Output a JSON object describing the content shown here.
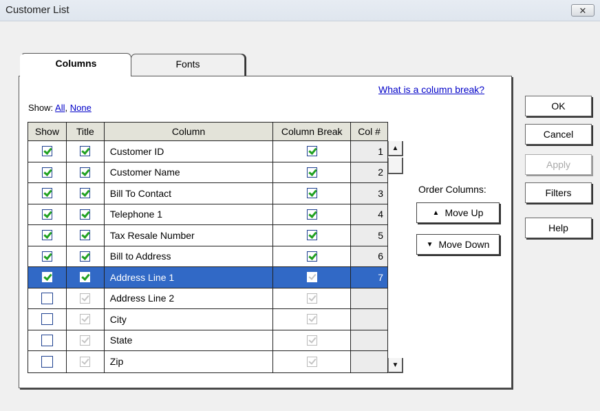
{
  "window": {
    "title": "Customer List",
    "close_glyph": "✕"
  },
  "tabs": [
    {
      "label": "Columns",
      "active": true
    },
    {
      "label": "Fonts",
      "active": false
    }
  ],
  "links": {
    "column_break_help": "What is a column break?"
  },
  "show": {
    "label": "Show:",
    "all": "All",
    "sep": ",",
    "none": "None"
  },
  "grid": {
    "headers": {
      "show": "Show",
      "title": "Title",
      "column": "Column",
      "column_break": "Column Break",
      "col_num": "Col #"
    },
    "rows": [
      {
        "show": true,
        "title": true,
        "column": "Customer ID",
        "column_break": true,
        "col_num": "1",
        "state": "normal"
      },
      {
        "show": true,
        "title": true,
        "column": "Customer Name",
        "column_break": true,
        "col_num": "2",
        "state": "normal"
      },
      {
        "show": true,
        "title": true,
        "column": "Bill To Contact",
        "column_break": true,
        "col_num": "3",
        "state": "normal"
      },
      {
        "show": true,
        "title": true,
        "column": "Telephone 1",
        "column_break": true,
        "col_num": "4",
        "state": "normal"
      },
      {
        "show": true,
        "title": true,
        "column": "Tax Resale Number",
        "column_break": true,
        "col_num": "5",
        "state": "normal"
      },
      {
        "show": true,
        "title": true,
        "column": "Bill to Address",
        "column_break": true,
        "col_num": "6",
        "state": "normal"
      },
      {
        "show": true,
        "title": true,
        "column": "Address Line 1",
        "column_break": true,
        "col_num": "7",
        "state": "selected"
      },
      {
        "show": false,
        "title": true,
        "column": "Address Line 2",
        "column_break": true,
        "col_num": "",
        "state": "disabled"
      },
      {
        "show": false,
        "title": true,
        "column": "City",
        "column_break": true,
        "col_num": "",
        "state": "disabled"
      },
      {
        "show": false,
        "title": true,
        "column": "State",
        "column_break": true,
        "col_num": "",
        "state": "disabled"
      },
      {
        "show": false,
        "title": true,
        "column": "Zip",
        "column_break": true,
        "col_num": "",
        "state": "disabled"
      }
    ]
  },
  "order": {
    "label": "Order Columns:",
    "move_up": "Move Up",
    "move_down": "Move Down",
    "up_arrow": "▲",
    "down_arrow": "▼"
  },
  "buttons": {
    "ok": "OK",
    "cancel": "Cancel",
    "apply": "Apply",
    "filters": "Filters",
    "help": "Help"
  },
  "colors": {
    "selected_row": "#3169c6",
    "check_green": "#21a121",
    "link_blue": "#0000c8",
    "header_bg": "#e3e3d9"
  },
  "icons": [
    "close-icon",
    "scroll-up-arrow-icon",
    "scroll-down-arrow-icon",
    "up-arrow-icon",
    "down-arrow-icon",
    "checkmark-icon"
  ]
}
